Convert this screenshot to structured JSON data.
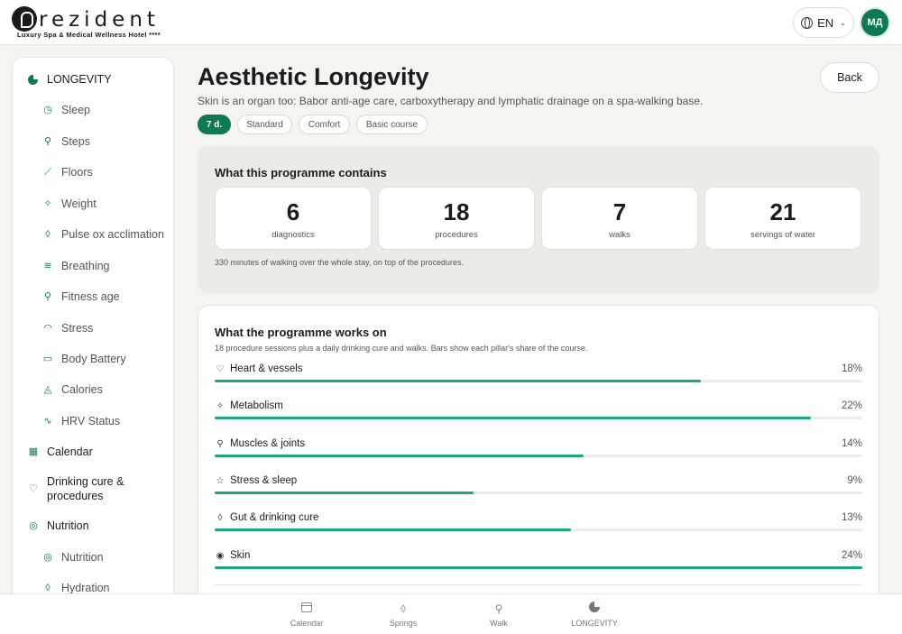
{
  "header": {
    "logo_word": "rezident",
    "logo_sub": "Luxury Spa & Medical Wellness Hotel ****",
    "lang": "EN",
    "avatar_initials": "МД"
  },
  "sidebar": {
    "items": [
      {
        "label": "LONGEVITY",
        "icon": "longevity-icon",
        "level": "top"
      },
      {
        "label": "Sleep",
        "icon": "clock-icon",
        "level": "sub"
      },
      {
        "label": "Steps",
        "icon": "walker-icon",
        "level": "sub"
      },
      {
        "label": "Floors",
        "icon": "stairs-icon",
        "level": "sub"
      },
      {
        "label": "Weight",
        "icon": "sparkle-icon",
        "level": "sub"
      },
      {
        "label": "Pulse ox acclimation",
        "icon": "drop-icon",
        "level": "sub"
      },
      {
        "label": "Breathing",
        "icon": "wind-icon",
        "level": "sub"
      },
      {
        "label": "Fitness age",
        "icon": "runner-icon",
        "level": "sub"
      },
      {
        "label": "Stress",
        "icon": "gauge-icon",
        "level": "sub"
      },
      {
        "label": "Body Battery",
        "icon": "battery-icon",
        "level": "sub"
      },
      {
        "label": "Calories",
        "icon": "flame-icon",
        "level": "sub"
      },
      {
        "label": "HRV Status",
        "icon": "pulse-icon",
        "level": "sub"
      },
      {
        "label": "Calendar",
        "icon": "calendar-icon",
        "level": "top"
      },
      {
        "label": "Drinking cure &",
        "label2": "procedures",
        "icon": "heart-icon",
        "level": "top"
      },
      {
        "label": "Nutrition",
        "icon": "target-icon",
        "level": "top"
      },
      {
        "label": "Nutrition",
        "icon": "target-icon",
        "level": "sub"
      },
      {
        "label": "Hydration",
        "icon": "drop-icon",
        "level": "sub"
      }
    ]
  },
  "main": {
    "title": "Aesthetic Longevity",
    "subtitle": "Skin is an organ too: Babor anti-age care, carboxytherapy and lymphatic drainage on a spa-walking base.",
    "back_label": "Back",
    "chips": [
      "7 d.",
      "Standard",
      "Comfort",
      "Basic course"
    ],
    "contains": {
      "title": "What this programme contains",
      "stats": [
        {
          "value": "6",
          "label": "diagnostics"
        },
        {
          "value": "18",
          "label": "procedures"
        },
        {
          "value": "7",
          "label": "walks"
        },
        {
          "value": "21",
          "label": "servings of water"
        }
      ],
      "note": "330 minutes of walking over the whole stay, on top of the procedures."
    },
    "works_on": {
      "title": "What the programme works on",
      "note": "18 procedure sessions plus a daily drinking cure and walks. Bars show each pillar's share of the course.",
      "pillars": [
        {
          "name": "Heart & vessels",
          "pct": "18%",
          "fill": 0.75,
          "icon": "heart-icon"
        },
        {
          "name": "Metabolism",
          "pct": "22%",
          "fill": 0.92,
          "icon": "sparkle-icon"
        },
        {
          "name": "Muscles & joints",
          "pct": "14%",
          "fill": 0.57,
          "icon": "runner-icon"
        },
        {
          "name": "Stress & sleep",
          "pct": "9%",
          "fill": 0.4,
          "icon": "star-icon"
        },
        {
          "name": "Gut & drinking cure",
          "pct": "13%",
          "fill": 0.55,
          "icon": "drop-icon"
        },
        {
          "name": "Skin",
          "pct": "24%",
          "fill": 1.0,
          "icon": "eye-icon"
        }
      ]
    }
  },
  "bottomnav": {
    "items": [
      {
        "label": "Calendar",
        "icon": "calendar-icon"
      },
      {
        "label": "Springs",
        "icon": "drop-icon"
      },
      {
        "label": "Walk",
        "icon": "walker-icon"
      },
      {
        "label": "LONGEVITY",
        "icon": "longevity-icon"
      }
    ]
  },
  "colors": {
    "brand": "#0d7a52",
    "bar": "#1ba97a"
  }
}
